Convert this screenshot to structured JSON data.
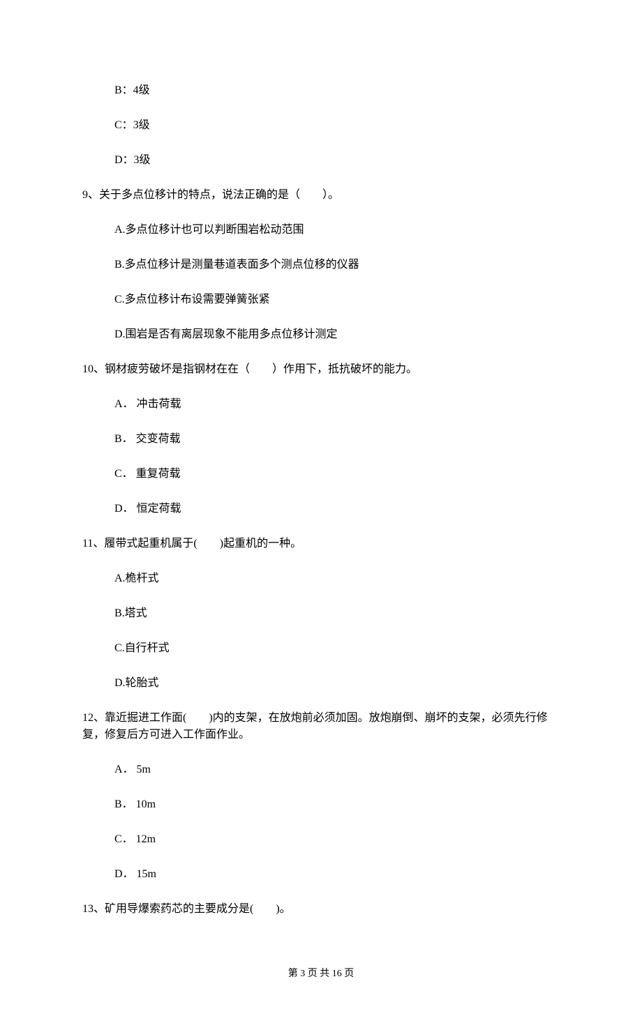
{
  "options_q8": {
    "b": "B：4级",
    "c": "C：3级",
    "d": "D：3级"
  },
  "q9": {
    "stem": "9、关于多点位移计的特点，说法正确的是（　　）。",
    "a": "A.多点位移计也可以判断围岩松动范围",
    "b": "B.多点位移计是测量巷道表面多个测点位移的仪器",
    "c": "C.多点位移计布设需要弹簧张紧",
    "d": "D.围岩是否有离层现象不能用多点位移计测定"
  },
  "q10": {
    "stem": "10、钢材疲劳破坏是指钢材在在（　　）作用下，抵抗破坏的能力。",
    "a": "A． 冲击荷载",
    "b": "B． 交变荷载",
    "c": "C． 重复荷载",
    "d": "D． 恒定荷载"
  },
  "q11": {
    "stem": "11、履带式起重机属于(　　)起重机的一种。",
    "a": "A.桅杆式",
    "b": "B.塔式",
    "c": "C.自行杆式",
    "d": "D.轮胎式"
  },
  "q12": {
    "stem": "12、靠近掘进工作面(　　)内的支架，在放炮前必须加固。放炮崩倒、崩坏的支架，必须先行修复，修复后方可进入工作面作业。",
    "a": "A． 5m",
    "b": "B． 10m",
    "c": "C． 12m",
    "d": "D． 15m"
  },
  "q13": {
    "stem": "13、矿用导爆索药芯的主要成分是(　　)。"
  },
  "footer": "第 3 页 共 16 页"
}
